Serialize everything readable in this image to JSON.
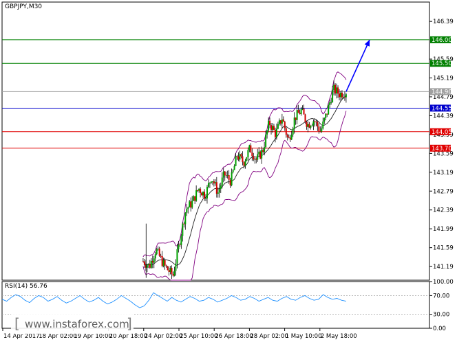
{
  "chart_data": {
    "type": "candlestick",
    "symbol_label": "GBPJPY,M30",
    "price_axis": {
      "ylim": [
        140.9,
        146.8
      ],
      "tick_labels": [
        "146.39",
        "145.59",
        "145.19",
        "144.79",
        "144.39",
        "143.99",
        "143.59",
        "143.19",
        "142.79",
        "142.39",
        "141.99",
        "141.59",
        "141.19"
      ],
      "tick_values": [
        146.39,
        145.59,
        145.19,
        144.79,
        144.39,
        143.99,
        143.59,
        143.19,
        142.79,
        142.39,
        141.99,
        141.59,
        141.19
      ]
    },
    "levels": [
      {
        "label": "146.00",
        "value": 146.0,
        "color": "#008000"
      },
      {
        "label": "145.50",
        "value": 145.5,
        "color": "#008000"
      },
      {
        "label": "144.90",
        "value": 144.9,
        "color": "#a0a0a0"
      },
      {
        "label": "144.55",
        "value": 144.55,
        "color": "#0000cc"
      },
      {
        "label": "144.05",
        "value": 144.05,
        "color": "#e00000"
      },
      {
        "label": "143.70",
        "value": 143.7,
        "color": "#e00000"
      }
    ],
    "x_axis": {
      "tick_labels": [
        "14 Apr 2017",
        "18 Apr 02:00",
        "19 Apr 10:00",
        "20 Apr 18:00",
        "24 Apr 02:00",
        "25 Apr 10:00",
        "26 Apr 18:00",
        "28 Apr 02:00",
        "1 May 10:00",
        "2 May 18:00"
      ]
    },
    "price_path": [
      [
        0.33,
        141.3
      ],
      [
        0.345,
        141.2
      ],
      [
        0.36,
        141.55
      ],
      [
        0.38,
        141.2
      ],
      [
        0.4,
        141.0
      ],
      [
        0.415,
        141.7
      ],
      [
        0.43,
        142.4
      ],
      [
        0.445,
        142.55
      ],
      [
        0.46,
        142.85
      ],
      [
        0.475,
        142.7
      ],
      [
        0.49,
        143.1
      ],
      [
        0.505,
        142.75
      ],
      [
        0.52,
        143.15
      ],
      [
        0.535,
        143.0
      ],
      [
        0.55,
        143.55
      ],
      [
        0.565,
        143.4
      ],
      [
        0.58,
        143.7
      ],
      [
        0.595,
        143.45
      ],
      [
        0.61,
        143.65
      ],
      [
        0.625,
        144.25
      ],
      [
        0.64,
        144.0
      ],
      [
        0.655,
        144.35
      ],
      [
        0.67,
        143.85
      ],
      [
        0.685,
        144.35
      ],
      [
        0.7,
        144.5
      ],
      [
        0.715,
        144.2
      ],
      [
        0.73,
        144.3
      ],
      [
        0.745,
        144.05
      ],
      [
        0.76,
        144.45
      ],
      [
        0.775,
        144.95
      ],
      [
        0.79,
        144.85
      ],
      [
        0.805,
        144.9
      ]
    ],
    "forecast_arrow": {
      "from": [
        0.805,
        144.9
      ],
      "to": [
        0.86,
        146.0
      ],
      "color": "#0000ff"
    },
    "rsi": {
      "label": "RSI(14) 56.76",
      "ylim": [
        0,
        100
      ],
      "tick_labels": [
        "100.00",
        "70.00",
        "30.00",
        "0.00"
      ],
      "tick_values": [
        100,
        70,
        30,
        0
      ],
      "levels": [
        70,
        30
      ],
      "values": [
        62,
        58,
        66,
        72,
        68,
        60,
        55,
        64,
        70,
        66,
        58,
        62,
        68,
        60,
        54,
        58,
        64,
        70,
        62,
        56,
        60,
        66,
        58,
        52,
        56,
        62,
        70,
        64,
        58,
        50,
        44,
        48,
        60,
        76,
        70,
        64,
        58,
        66,
        60,
        56,
        62,
        68,
        64,
        58,
        60,
        66,
        62,
        56,
        60,
        64,
        70,
        66,
        60,
        62,
        68,
        64,
        58,
        62,
        66,
        60,
        58,
        64,
        68,
        62,
        60,
        66,
        70,
        64,
        60,
        62,
        72,
        66,
        62,
        64,
        60,
        58
      ],
      "color": "#1e90ff"
    }
  },
  "watermark": "www.instaforex.com"
}
